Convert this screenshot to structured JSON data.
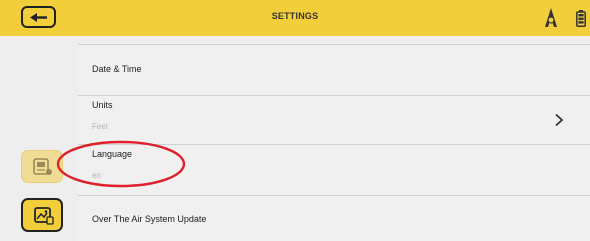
{
  "header": {
    "title": "SETTINGS",
    "back_icon": "arrow-left-icon",
    "logo_icon": "hiker-logo-icon",
    "battery_icon": "battery-icon",
    "accent_color": "#f2cf3a"
  },
  "settings": {
    "date_time": {
      "label": "Date & Time"
    },
    "units": {
      "label": "Units",
      "value": "Feet"
    },
    "language": {
      "label": "Language",
      "value": "en"
    },
    "ota": {
      "label": "Over The Air System Update"
    }
  },
  "sidebar": {
    "buttons": [
      {
        "icon": "device-settings-icon",
        "state": "faded"
      },
      {
        "icon": "system-update-icon",
        "state": "active"
      }
    ]
  },
  "annotation": {
    "shape": "ellipse",
    "color": "#e0202a",
    "target": "language"
  }
}
